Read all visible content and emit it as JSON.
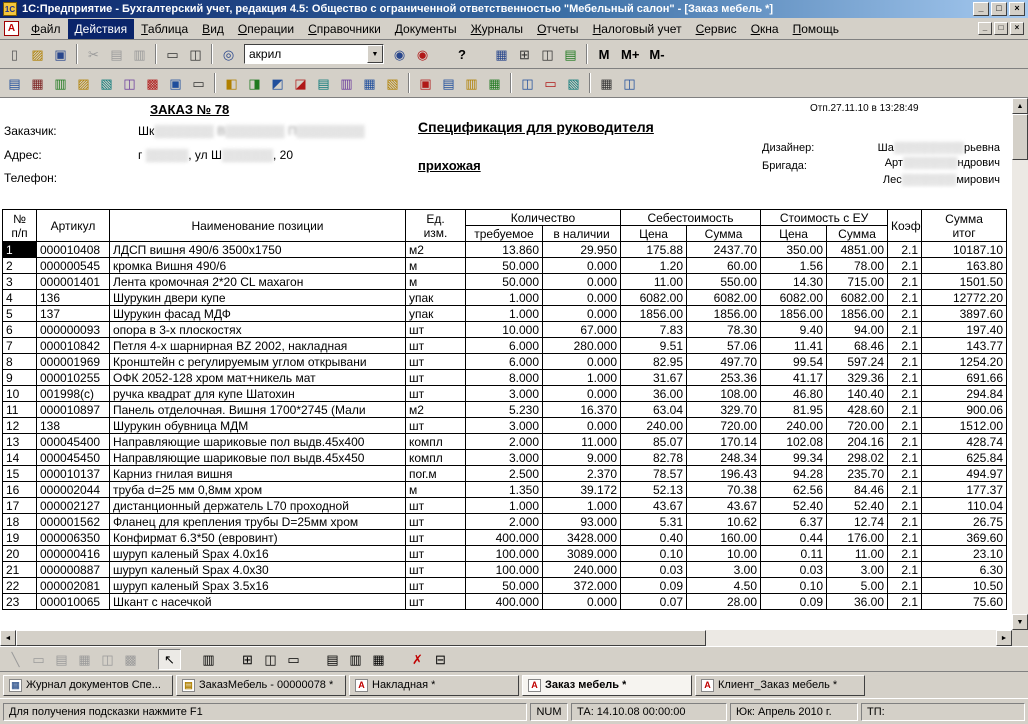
{
  "window": {
    "title": "1С:Предприятие - Бухгалтерский учет, редакция 4.5: Общество с ограниченной ответственностью \"Мебельный салон\" - [Заказ мебель  *]",
    "badge": "1С",
    "controls": {
      "minimize": "_",
      "maximize": "□",
      "close": "×"
    }
  },
  "menu": {
    "doc_icon": "А",
    "items": [
      {
        "name": "file",
        "label": "Файл"
      },
      {
        "name": "actions",
        "label": "Действия",
        "active": true
      },
      {
        "name": "table",
        "label": "Таблица"
      },
      {
        "name": "view",
        "label": "Вид"
      },
      {
        "name": "operations",
        "label": "Операции"
      },
      {
        "name": "references",
        "label": "Справочники"
      },
      {
        "name": "documents",
        "label": "Документы"
      },
      {
        "name": "journals",
        "label": "Журналы"
      },
      {
        "name": "reports",
        "label": "Отчеты"
      },
      {
        "name": "tax-accounting",
        "label": "Налоговый учет"
      },
      {
        "name": "service",
        "label": "Сервис"
      },
      {
        "name": "windows",
        "label": "Окна"
      },
      {
        "name": "help",
        "label": "Помощь"
      }
    ]
  },
  "toolbar_main": {
    "combo": {
      "value": "акрил"
    },
    "items": [
      {
        "name": "new-document",
        "glyph": "▯",
        "fg": "#555555"
      },
      {
        "name": "open",
        "glyph": "▨",
        "fg": "#b08000"
      },
      {
        "name": "save",
        "glyph": "▣",
        "fg": "#28468c"
      },
      {
        "sep": true
      },
      {
        "name": "cut",
        "glyph": "✂",
        "fg": "#555555",
        "disabled": true
      },
      {
        "name": "copy",
        "glyph": "▤",
        "fg": "#555555",
        "disabled": true
      },
      {
        "name": "paste",
        "glyph": "▥",
        "fg": "#555555",
        "disabled": true
      },
      {
        "sep": true
      },
      {
        "name": "print",
        "glyph": "▭",
        "fg": "#333333"
      },
      {
        "name": "print-preview",
        "glyph": "◫",
        "fg": "#333333"
      },
      {
        "sep": true
      },
      {
        "name": "find",
        "glyph": "◎",
        "fg": "#28468c"
      },
      {
        "combo": true
      },
      {
        "name": "find-next",
        "glyph": "◉",
        "fg": "#28468c"
      },
      {
        "name": "find-previous",
        "glyph": "◉",
        "fg": "#b01818"
      },
      {
        "gap": true
      },
      {
        "name": "help",
        "text": "?"
      },
      {
        "gap": true
      },
      {
        "name": "table-view",
        "glyph": "▦",
        "fg": "#28468c"
      },
      {
        "name": "table-edit",
        "glyph": "⊞",
        "fg": "#333333"
      },
      {
        "name": "freeze-table",
        "glyph": "◫",
        "fg": "#333333"
      },
      {
        "name": "refresh-table",
        "glyph": "▤",
        "fg": "#1f7a1f"
      },
      {
        "sep": true
      },
      {
        "name": "memory-recall",
        "text": "М"
      },
      {
        "name": "memory-add",
        "text": "М+"
      },
      {
        "name": "memory-subtract",
        "text": "М-"
      }
    ]
  },
  "toolbar_accounting": {
    "items": [
      {
        "name": "constants",
        "glyph": "▤",
        "fg": "#1f4e9c"
      },
      {
        "name": "chart-of-accounts",
        "glyph": "▦",
        "fg": "#7a1f1f"
      },
      {
        "name": "operation-journal",
        "glyph": "▥",
        "fg": "#1f7a1f"
      },
      {
        "name": "documents-journal",
        "glyph": "▨",
        "fg": "#b08000"
      },
      {
        "name": "references",
        "glyph": "▧",
        "fg": "#0c7a7a"
      },
      {
        "name": "reports",
        "glyph": "◫",
        "fg": "#6a3a9c"
      },
      {
        "name": "processing",
        "glyph": "▩",
        "fg": "#b01818"
      },
      {
        "name": "table-document",
        "glyph": "▣",
        "fg": "#1f4e9c"
      },
      {
        "name": "calculator",
        "glyph": "▭",
        "fg": "#333333"
      },
      {
        "sep": true
      },
      {
        "name": "nomenclature",
        "glyph": "◧",
        "fg": "#b08000"
      },
      {
        "name": "materials",
        "glyph": "◨",
        "fg": "#1f7a1f"
      },
      {
        "name": "contractors",
        "glyph": "◩",
        "fg": "#1f4e9c"
      },
      {
        "name": "employees",
        "glyph": "◪",
        "fg": "#b01818"
      },
      {
        "name": "warehouses",
        "glyph": "▤",
        "fg": "#0c7a7a"
      },
      {
        "name": "currencies",
        "glyph": "▥",
        "fg": "#6a3a9c"
      },
      {
        "name": "banks",
        "glyph": "▦",
        "fg": "#1f4e9c"
      },
      {
        "name": "cash",
        "glyph": "▧",
        "fg": "#b08000"
      },
      {
        "sep": true
      },
      {
        "name": "invoice-doc",
        "glyph": "▣",
        "fg": "#b01818"
      },
      {
        "name": "payment-doc",
        "glyph": "▤",
        "fg": "#1f4e9c"
      },
      {
        "name": "receipt-doc",
        "glyph": "▥",
        "fg": "#b08000"
      },
      {
        "name": "expense-doc",
        "glyph": "▦",
        "fg": "#1f7a1f"
      },
      {
        "sep": true
      },
      {
        "name": "turnover-report",
        "glyph": "◫",
        "fg": "#1f4e9c"
      },
      {
        "name": "account-card",
        "glyph": "▭",
        "fg": "#b01818"
      },
      {
        "name": "analysis-report",
        "glyph": "▧",
        "fg": "#0c7a7a"
      },
      {
        "sep": true
      },
      {
        "name": "calendar",
        "glyph": "▦",
        "fg": "#333333"
      },
      {
        "name": "monitor",
        "glyph": "◫",
        "fg": "#1f4e9c"
      }
    ]
  },
  "document": {
    "order_title": "ЗАКАЗ № 78",
    "printed": "Отп.27.11.10 в 13:28:49",
    "spec_title": "Спецификация для руководителя",
    "room": "прихожая",
    "fields": [
      {
        "name": "customer",
        "label": "Заказчик:",
        "segments": [
          {
            "t": "Шк"
          },
          {
            "t": "▒▒▒▒▒▒▒ В▒▒▒▒▒▒▒ П▒▒▒▒▒▒▒▒",
            "m": true
          }
        ]
      },
      {
        "name": "address",
        "label": "Адрес:",
        "segments": [
          {
            "t": "г "
          },
          {
            "t": "▒▒▒▒▒",
            "m": true
          },
          {
            "t": ", ул Ш"
          },
          {
            "t": "▒▒▒▒▒▒",
            "m": true
          },
          {
            "t": ", 20"
          }
        ]
      },
      {
        "name": "phone",
        "label": "Телефон:",
        "segments": []
      }
    ],
    "designer_label": "Дизайнер:",
    "designer_segments": [
      {
        "t": "Ша"
      },
      {
        "t": "▒▒▒▒▒▒▒▒▒",
        "m": true
      },
      {
        "t": "рьевна"
      }
    ],
    "brigade_label": "Бригада:",
    "brigade_lines": [
      [
        {
          "t": "Арт"
        },
        {
          "t": "▒▒▒▒▒▒▒",
          "m": true
        },
        {
          "t": "ндрович"
        }
      ],
      [
        {
          "t": "Лес"
        },
        {
          "t": "▒▒▒▒▒▒▒",
          "m": true
        },
        {
          "t": "мирович"
        }
      ]
    ]
  },
  "table": {
    "group_headers": [
      {
        "name": "num",
        "lines": [
          "№",
          "п/п"
        ],
        "rowspan": 2
      },
      {
        "name": "article",
        "label": "Артикул",
        "rowspan": 2
      },
      {
        "name": "position-name",
        "label": "Наименование позиции",
        "rowspan": 2
      },
      {
        "name": "unit",
        "lines": [
          "Ед.",
          "изм."
        ],
        "rowspan": 2
      },
      {
        "name": "quantity-group",
        "label": "Количество",
        "colspan": 2
      },
      {
        "name": "cost-group",
        "label": "Себестоимость",
        "colspan": 2
      },
      {
        "name": "eu-cost-group",
        "label": "Стоимость с ЕУ",
        "colspan": 2
      },
      {
        "name": "coefficient",
        "label": "Коэф.",
        "rowspan": 2
      },
      {
        "name": "total",
        "lines": [
          "Сумма",
          "итог"
        ],
        "rowspan": 2
      }
    ],
    "sub_headers": [
      {
        "name": "qty-required",
        "label": "требуемое"
      },
      {
        "name": "qty-available",
        "label": "в наличии"
      },
      {
        "name": "cost-price",
        "label": "Цена"
      },
      {
        "name": "cost-sum",
        "label": "Сумма"
      },
      {
        "name": "eu-price",
        "label": "Цена"
      },
      {
        "name": "eu-sum",
        "label": "Сумма"
      }
    ],
    "selected_cell": {
      "row": 0,
      "col": 0
    },
    "rows": [
      [
        "1",
        "000010408",
        "ЛДСП вишня 490/6 3500х1750",
        "м2",
        "13.860",
        "29.950",
        "175.88",
        "2437.70",
        "350.00",
        "4851.00",
        "2.1",
        "10187.10"
      ],
      [
        "2",
        "000000545",
        "кромка Вишня 490/6",
        "м",
        "50.000",
        "0.000",
        "1.20",
        "60.00",
        "1.56",
        "78.00",
        "2.1",
        "163.80"
      ],
      [
        "3",
        "000001401",
        "Лента кромочная 2*20 CL махагон",
        "м",
        "50.000",
        "0.000",
        "11.00",
        "550.00",
        "14.30",
        "715.00",
        "2.1",
        "1501.50"
      ],
      [
        "4",
        "136",
        "Шурукин двери купе",
        "упак",
        "1.000",
        "0.000",
        "6082.00",
        "6082.00",
        "6082.00",
        "6082.00",
        "2.1",
        "12772.20"
      ],
      [
        "5",
        "137",
        "Шурукин фасад МДФ",
        "упак",
        "1.000",
        "0.000",
        "1856.00",
        "1856.00",
        "1856.00",
        "1856.00",
        "2.1",
        "3897.60"
      ],
      [
        "6",
        "000000093",
        "опора в 3-х плоскостях",
        "шт",
        "10.000",
        "67.000",
        "7.83",
        "78.30",
        "9.40",
        "94.00",
        "2.1",
        "197.40"
      ],
      [
        "7",
        "000010842",
        "Петля 4-х шарнирная BZ 2002, накладная",
        "шт",
        "6.000",
        "280.000",
        "9.51",
        "57.06",
        "11.41",
        "68.46",
        "2.1",
        "143.77"
      ],
      [
        "8",
        "000001969",
        "Кронштейн с регулируемым углом открывани",
        "шт",
        "6.000",
        "0.000",
        "82.95",
        "497.70",
        "99.54",
        "597.24",
        "2.1",
        "1254.20"
      ],
      [
        "9",
        "000010255",
        "ОФК 2052-128 хром мат+никель мат",
        "шт",
        "8.000",
        "1.000",
        "31.67",
        "253.36",
        "41.17",
        "329.36",
        "2.1",
        "691.66"
      ],
      [
        "10",
        "001998(с)",
        "ручка квадрат для купе Шатохин",
        "шт",
        "3.000",
        "0.000",
        "36.00",
        "108.00",
        "46.80",
        "140.40",
        "2.1",
        "294.84"
      ],
      [
        "11",
        "000010897",
        "Панель отделочная. Вишня 1700*2745 (Мали",
        "м2",
        "5.230",
        "16.370",
        "63.04",
        "329.70",
        "81.95",
        "428.60",
        "2.1",
        "900.06"
      ],
      [
        "12",
        "138",
        "Шурукин обувница МДМ",
        "шт",
        "3.000",
        "0.000",
        "240.00",
        "720.00",
        "240.00",
        "720.00",
        "2.1",
        "1512.00"
      ],
      [
        "13",
        "000045400",
        "Направляющие шариковые пол выдв.45х400",
        "компл",
        "2.000",
        "11.000",
        "85.07",
        "170.14",
        "102.08",
        "204.16",
        "2.1",
        "428.74"
      ],
      [
        "14",
        "000045450",
        "Направляющие шариковые пол выдв.45х450",
        "компл",
        "3.000",
        "9.000",
        "82.78",
        "248.34",
        "99.34",
        "298.02",
        "2.1",
        "625.84"
      ],
      [
        "15",
        "000010137",
        "Карниз гнилая вишня",
        "пог.м",
        "2.500",
        "2.370",
        "78.57",
        "196.43",
        "94.28",
        "235.70",
        "2.1",
        "494.97"
      ],
      [
        "16",
        "000002044",
        "труба d=25 мм 0,8мм хром",
        "м",
        "1.350",
        "39.172",
        "52.13",
        "70.38",
        "62.56",
        "84.46",
        "2.1",
        "177.37"
      ],
      [
        "17",
        "000002127",
        "дистанционный держатель L70 проходной",
        "шт",
        "1.000",
        "1.000",
        "43.67",
        "43.67",
        "52.40",
        "52.40",
        "2.1",
        "110.04"
      ],
      [
        "18",
        "000001562",
        "Фланец для крепления трубы D=25мм хром",
        "шт",
        "2.000",
        "93.000",
        "5.31",
        "10.62",
        "6.37",
        "12.74",
        "2.1",
        "26.75"
      ],
      [
        "19",
        "000006350",
        "Конфирмат 6.3*50 (евровинт)",
        "шт",
        "400.000",
        "3428.000",
        "0.40",
        "160.00",
        "0.44",
        "176.00",
        "2.1",
        "369.60"
      ],
      [
        "20",
        "000000416",
        "шуруп каленый Spax 4.0х16",
        "шт",
        "100.000",
        "3089.000",
        "0.10",
        "10.00",
        "0.11",
        "11.00",
        "2.1",
        "23.10"
      ],
      [
        "21",
        "000000887",
        "шуруп каленый Spax 4.0х30",
        "шт",
        "100.000",
        "240.000",
        "0.03",
        "3.00",
        "0.03",
        "3.00",
        "2.1",
        "6.30"
      ],
      [
        "22",
        "000002081",
        "шуруп каленый Spax 3.5х16",
        "шт",
        "50.000",
        "372.000",
        "0.09",
        "4.50",
        "0.10",
        "5.00",
        "2.1",
        "10.50"
      ],
      [
        "23",
        "000010065",
        "Шкант с насечкой",
        "шт",
        "400.000",
        "0.000",
        "0.07",
        "28.00",
        "0.09",
        "36.00",
        "2.1",
        "75.60"
      ]
    ]
  },
  "drawbar": {
    "items": [
      {
        "name": "line-tool",
        "glyph": "╲",
        "disabled": true
      },
      {
        "name": "rectangle-tool",
        "glyph": "▭",
        "disabled": true
      },
      {
        "name": "text-tool",
        "glyph": "▤",
        "disabled": true
      },
      {
        "name": "picture-tool",
        "glyph": "▦",
        "disabled": true
      },
      {
        "name": "ole-tool",
        "glyph": "◫",
        "disabled": true
      },
      {
        "name": "diagram-tool",
        "glyph": "▩",
        "disabled": true
      },
      {
        "gap": true
      },
      {
        "name": "pointer-tool",
        "glyph": "↖",
        "active": true
      },
      {
        "gap": true
      },
      {
        "name": "section-names",
        "glyph": "▥"
      },
      {
        "gap": true
      },
      {
        "name": "insert-section",
        "glyph": "⊞"
      },
      {
        "name": "column-widths",
        "glyph": "◫"
      },
      {
        "name": "merge-cells",
        "glyph": "▭"
      },
      {
        "gap": true
      },
      {
        "name": "show-sections",
        "glyph": "▤"
      },
      {
        "name": "show-headers",
        "glyph": "▥"
      },
      {
        "name": "show-grid",
        "glyph": "▦"
      },
      {
        "gap": true
      },
      {
        "name": "view-only",
        "glyph": "✗",
        "fg": "#c00000"
      },
      {
        "name": "black-white-view",
        "glyph": "⊟"
      }
    ]
  },
  "tabs": [
    {
      "name": "tab-documents-journal",
      "icon": "▦",
      "icon_fg": "#4a6a9c",
      "icon_name": "journal-icon",
      "label": "Журнал документов  Спе..."
    },
    {
      "name": "tab-order-document",
      "icon": "▤",
      "icon_fg": "#b08000",
      "icon_name": "document-icon",
      "label": "ЗаказМебель - 00000078 *"
    },
    {
      "name": "tab-invoice-print",
      "icon": "А",
      "icon_fg": "#c00000",
      "icon_name": "moxel-icon",
      "label": "Накладная  *"
    },
    {
      "name": "tab-order-print",
      "icon": "А",
      "icon_fg": "#c00000",
      "icon_name": "moxel-icon",
      "label": "Заказ мебель  *",
      "active": true
    },
    {
      "name": "tab-client-order-print",
      "icon": "А",
      "icon_fg": "#c00000",
      "icon_name": "moxel-icon",
      "label": "Клиент_Заказ мебель  *"
    }
  ],
  "statusbar": {
    "help": "Для получения подсказки нажмите F1",
    "num": "NUM",
    "ta": "ТА: 14.10.08  00:00:00",
    "period": "Юк: Апрель 2010 г.",
    "tp": "ТП:"
  },
  "scroll": {
    "up": "▲",
    "down": "▼",
    "left": "◄",
    "right": "►"
  }
}
